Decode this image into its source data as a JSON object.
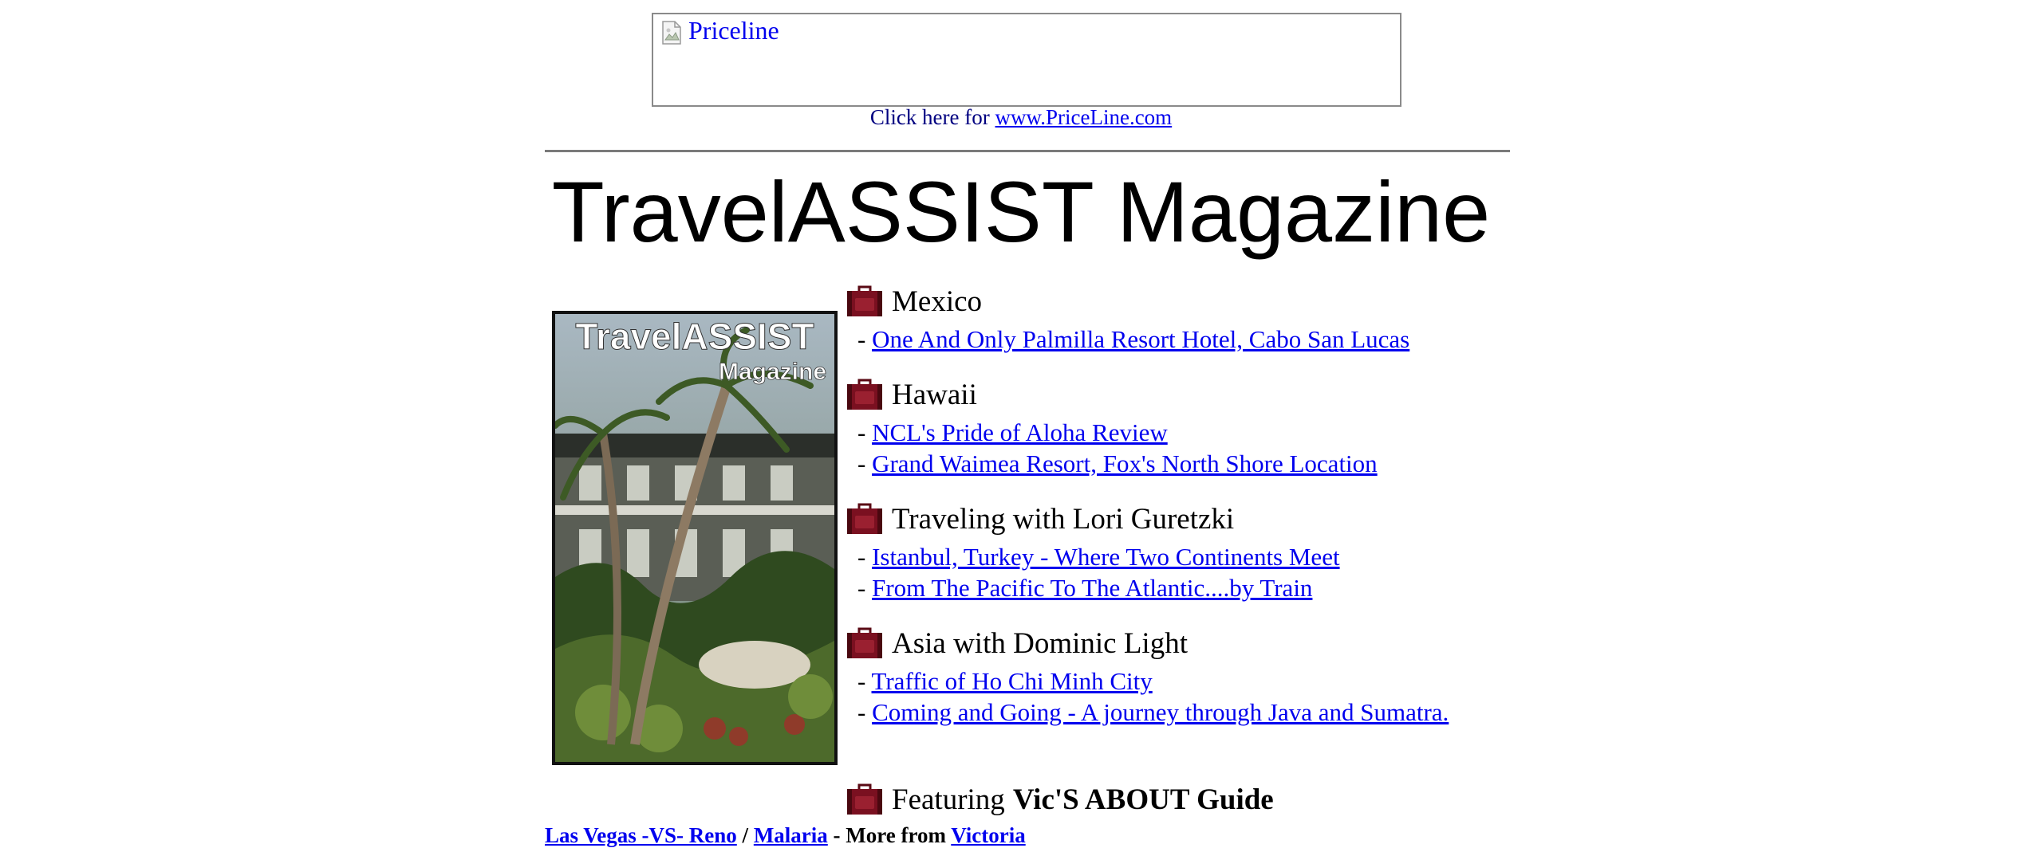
{
  "ad": {
    "alt_text": "Priceline",
    "click_prefix": "Click here for",
    "click_link": "www.PriceLine.com"
  },
  "title": "TravelASSIST Magazine",
  "cover": {
    "title": "TravelASSIST",
    "subtitle": "Magazine"
  },
  "sections": [
    {
      "heading": "Mexico",
      "items": [
        "One And Only Palmilla Resort Hotel, Cabo San Lucas"
      ]
    },
    {
      "heading": "Hawaii",
      "items": [
        "NCL's Pride of Aloha Review",
        "Grand Waimea Resort, Fox's North Shore Location"
      ]
    },
    {
      "heading": "Traveling with Lori Guretzki",
      "items": [
        "Istanbul, Turkey - Where Two Continents Meet",
        "From The Pacific To The Atlantic....by Train"
      ]
    },
    {
      "heading": "Asia with Dominic Light",
      "items": [
        "Traffic of Ho Chi Minh City",
        "Coming and Going - A journey through Java and Sumatra."
      ]
    }
  ],
  "featuring": {
    "prefix": "Featuring",
    "name": "Vic'S ABOUT Guide"
  },
  "bottom": {
    "link1": "Las Vegas -VS- Reno",
    "sep1": "/",
    "link2": "Malaria",
    "sep2": "- More from",
    "link3": "Victoria"
  },
  "colors": {
    "link": "#0000ee",
    "suitcase": "#7a1020"
  }
}
